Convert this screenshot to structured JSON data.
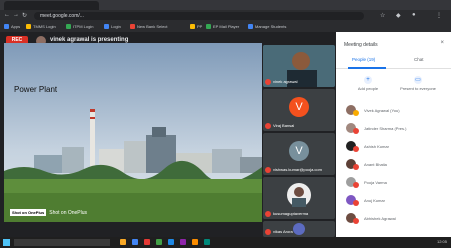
{
  "browser": {
    "url": "meet.google.com/...",
    "bookmarks": [
      "Apps",
      "TMMS Login",
      "ITPM Login",
      "Login",
      "New Bank Select",
      "PP",
      "EP Mail Player",
      "Manage Students"
    ]
  },
  "meet": {
    "rec_label": "REC",
    "presenting_text": "vinek agrawal is presenting"
  },
  "slide": {
    "title": "Power Plant",
    "shot_badge": "Shot on OnePlus",
    "shot_text": "Shot on OnePlus"
  },
  "tiles": [
    {
      "label": "vinek agrawal"
    },
    {
      "label": "Viraj Bansal",
      "initial": "V"
    },
    {
      "label": "vishwas.kumar@pooja.com",
      "initial": "V"
    },
    {
      "label": "kusumaguptaverma"
    },
    {
      "label": "vikas Arora"
    }
  ],
  "panel": {
    "title": "Meeting details",
    "close_icon": "×",
    "tabs": [
      "People (19)",
      "Chat"
    ],
    "actions": [
      "Add people",
      "Present to everyone"
    ],
    "people": [
      "Vivek Agrawal (You)",
      "Jatinder Sharma (Pres.)",
      "Ashish Kumar",
      "Anant Bhatia",
      "Pooja Varma",
      "Anuj Kumar",
      "Abhishek Agrawal"
    ]
  },
  "taskbar": {
    "time": "12:05"
  }
}
